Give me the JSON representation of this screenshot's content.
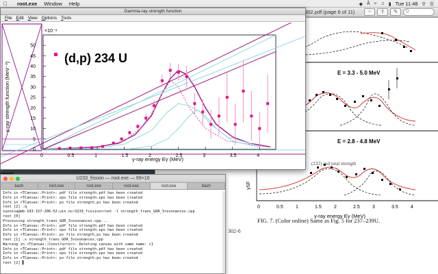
{
  "menubar": {
    "app_name": "root.exe",
    "items": [
      "Window",
      "Help"
    ],
    "clock": "Tue 11:48"
  },
  "pdf_window": {
    "title": "4302.pdf (page 6 of 11)",
    "search_placeholder": "Q",
    "panels": [
      {
        "label": "E = 3.3 - 5.0 MeV"
      },
      {
        "label": "E = 2.8 - 4.8 MeV"
      }
    ],
    "y_label": "γSF",
    "x_axis_label": "γ-ray energy Eγ (MeV)",
    "x_ticks": [
      "0",
      "0.5",
      "1",
      "1.5",
      "2",
      "2.5",
      "3",
      "3.5",
      "4"
    ],
    "caption": "FIG. 7. (Color online)  Same as Fig. 5 for 237–239U.",
    "hidden_text": "(232) and total strength",
    "page_ref": "302-6"
  },
  "terminal": {
    "title": "U233_fission — root.exe — 99×16",
    "tabs": [
      "bash",
      "root.exe",
      "root.exe",
      "root.exe",
      "root.exe",
      "bash"
    ],
    "active_tab": 4,
    "lines": [
      "Info in <TCanvas::Print>: pdf file strength.pdf has been created",
      "Info in <TCanvas::Print>: eps file strength.eps has been created",
      "Info in <TCanvas::Print>: ps file strength.ps has been created",
      "root [2] .q",
      "sunniva@mb-193-157-206-52:uio.no:U233_fission>root -l strength_trans_GDR_3resonances.cpp",
      "root [0]",
      "Processing strength_trans_GDR_3resonances.cpp...",
      "Info in <TCanvas::Print>: pdf file strength.pdf has been created",
      "Info in <TCanvas::Print>: eps file strength.eps has been created",
      "Info in <TCanvas::Print>: ps file strength.ps has been created",
      "root [1] .x strength_trans_GDR_3resonances.cpp",
      "Warning in <TCanvas::Constructor>: Deleting canvas with same name: c1",
      "Info in <TCanvas::Print>: pdf file strength.pdf has been created",
      "Info in <TCanvas::Print>: eps file strength.eps has been created",
      "Info in <TCanvas::Print>: ps file strength.ps has been created",
      "root [2] ▌"
    ]
  },
  "root_window": {
    "title": "Gamma-ray strength function",
    "menu": [
      "File",
      "Edit",
      "View",
      "Options",
      "Tools"
    ]
  },
  "chart_data": {
    "type": "scatter",
    "title": "(d,p) 234 U",
    "xlabel": "γ-ray energy Eγ (MeV)",
    "ylabel": "γ-ray strength function (MeV⁻³)",
    "y_multiplier": "×10⁻⁹",
    "xlim": [
      0,
      4.3
    ],
    "ylim": [
      0,
      55
    ],
    "x_ticks": [
      0,
      0.5,
      1,
      1.5,
      2,
      2.5,
      3,
      3.5,
      4
    ],
    "y_ticks": [
      0,
      5,
      10,
      15,
      20,
      25,
      30,
      35,
      40,
      45,
      50
    ],
    "series": [
      {
        "name": "(d,p) 234 U",
        "marker": "square",
        "color": "#e0158a",
        "points": [
          {
            "x": 0.3,
            "y": 0.4,
            "err": 0.3
          },
          {
            "x": 0.5,
            "y": 0.5,
            "err": 0.3
          },
          {
            "x": 0.7,
            "y": 0.7,
            "err": 0.3
          },
          {
            "x": 0.9,
            "y": 0.8,
            "err": 0.3
          },
          {
            "x": 1.1,
            "y": 1.4,
            "err": 0.4
          },
          {
            "x": 1.3,
            "y": 3.0,
            "err": 0.6
          },
          {
            "x": 1.45,
            "y": 5.0,
            "err": 0.8
          },
          {
            "x": 1.6,
            "y": 8.0,
            "err": 1.0
          },
          {
            "x": 1.75,
            "y": 11.0,
            "err": 1.5
          },
          {
            "x": 1.9,
            "y": 15.0,
            "err": 2.0
          },
          {
            "x": 2.05,
            "y": 21.0,
            "err": 2.5
          },
          {
            "x": 2.2,
            "y": 33.0,
            "err": 3.0
          },
          {
            "x": 2.35,
            "y": 38.0,
            "err": 3.5
          },
          {
            "x": 2.5,
            "y": 37.0,
            "err": 4.0
          },
          {
            "x": 2.65,
            "y": 35.0,
            "err": 5.0
          },
          {
            "x": 2.8,
            "y": 22.0,
            "err": 5.0
          },
          {
            "x": 2.95,
            "y": 18.0,
            "err": 6.0
          },
          {
            "x": 3.1,
            "y": 12.0,
            "err": 7.0
          },
          {
            "x": 3.25,
            "y": 16.0,
            "err": 9.0
          },
          {
            "x": 3.4,
            "y": 25.0,
            "err": 12.0
          },
          {
            "x": 3.55,
            "y": 12.0,
            "err": 10.0
          },
          {
            "x": 3.7,
            "y": 28.0,
            "err": 15.0
          },
          {
            "x": 3.85,
            "y": 16.0,
            "err": 12.0
          },
          {
            "x": 4.0,
            "y": 10.0,
            "err": 8.0
          },
          {
            "x": 4.15,
            "y": 22.0,
            "err": 14.0
          }
        ]
      },
      {
        "name": "",
        "type": "line",
        "color": "#a0157a",
        "x": [
          0,
          0.5,
          1.0,
          1.4,
          1.7,
          2.0,
          2.2,
          2.35,
          2.5,
          2.65,
          2.8,
          3.0,
          3.2,
          3.5,
          3.8,
          4.2
        ],
        "y": [
          0.2,
          0.5,
          1.2,
          3.0,
          7.0,
          16.0,
          27.0,
          34.0,
          38.0,
          36.0,
          30.0,
          20.0,
          12.0,
          6.0,
          3.0,
          1.2
        ]
      },
      {
        "name": "",
        "type": "line",
        "style": "dashed",
        "color": "#d24aa8",
        "x": [
          0,
          1.0,
          1.5,
          1.8,
          2.0,
          2.2,
          2.35,
          2.5,
          2.7,
          3.0,
          3.4,
          4.2
        ],
        "y": [
          0.2,
          1.0,
          4.0,
          10.0,
          17.0,
          27.0,
          33.0,
          30.0,
          20.0,
          10.0,
          4.0,
          1.0
        ]
      },
      {
        "name": "",
        "type": "line",
        "color": "#8fd8df",
        "x": [
          0,
          1.0,
          1.5,
          2.0,
          2.3,
          2.5,
          2.7,
          2.9,
          3.1,
          3.4,
          4.0
        ],
        "y": [
          0.1,
          0.6,
          2.5,
          9.0,
          18.0,
          22.0,
          21.0,
          18.0,
          12.0,
          6.0,
          1.5
        ]
      },
      {
        "name": "",
        "type": "line",
        "color": "#8fd8df",
        "x": [
          1.6,
          2.0,
          2.3,
          2.5,
          2.7,
          2.85,
          3.0,
          3.2,
          3.5,
          4.0
        ],
        "y": [
          0.2,
          1.5,
          5.0,
          10.0,
          16.0,
          19.0,
          16.0,
          10.0,
          4.0,
          1.0
        ]
      },
      {
        "name": "",
        "type": "line",
        "color": "#8fd8df",
        "x": [
          0,
          4.3
        ],
        "y": [
          0,
          55
        ]
      },
      {
        "name": "",
        "type": "line",
        "color": "#a0157a",
        "x": [
          0,
          4.3
        ],
        "y": [
          0,
          47
        ]
      }
    ]
  }
}
